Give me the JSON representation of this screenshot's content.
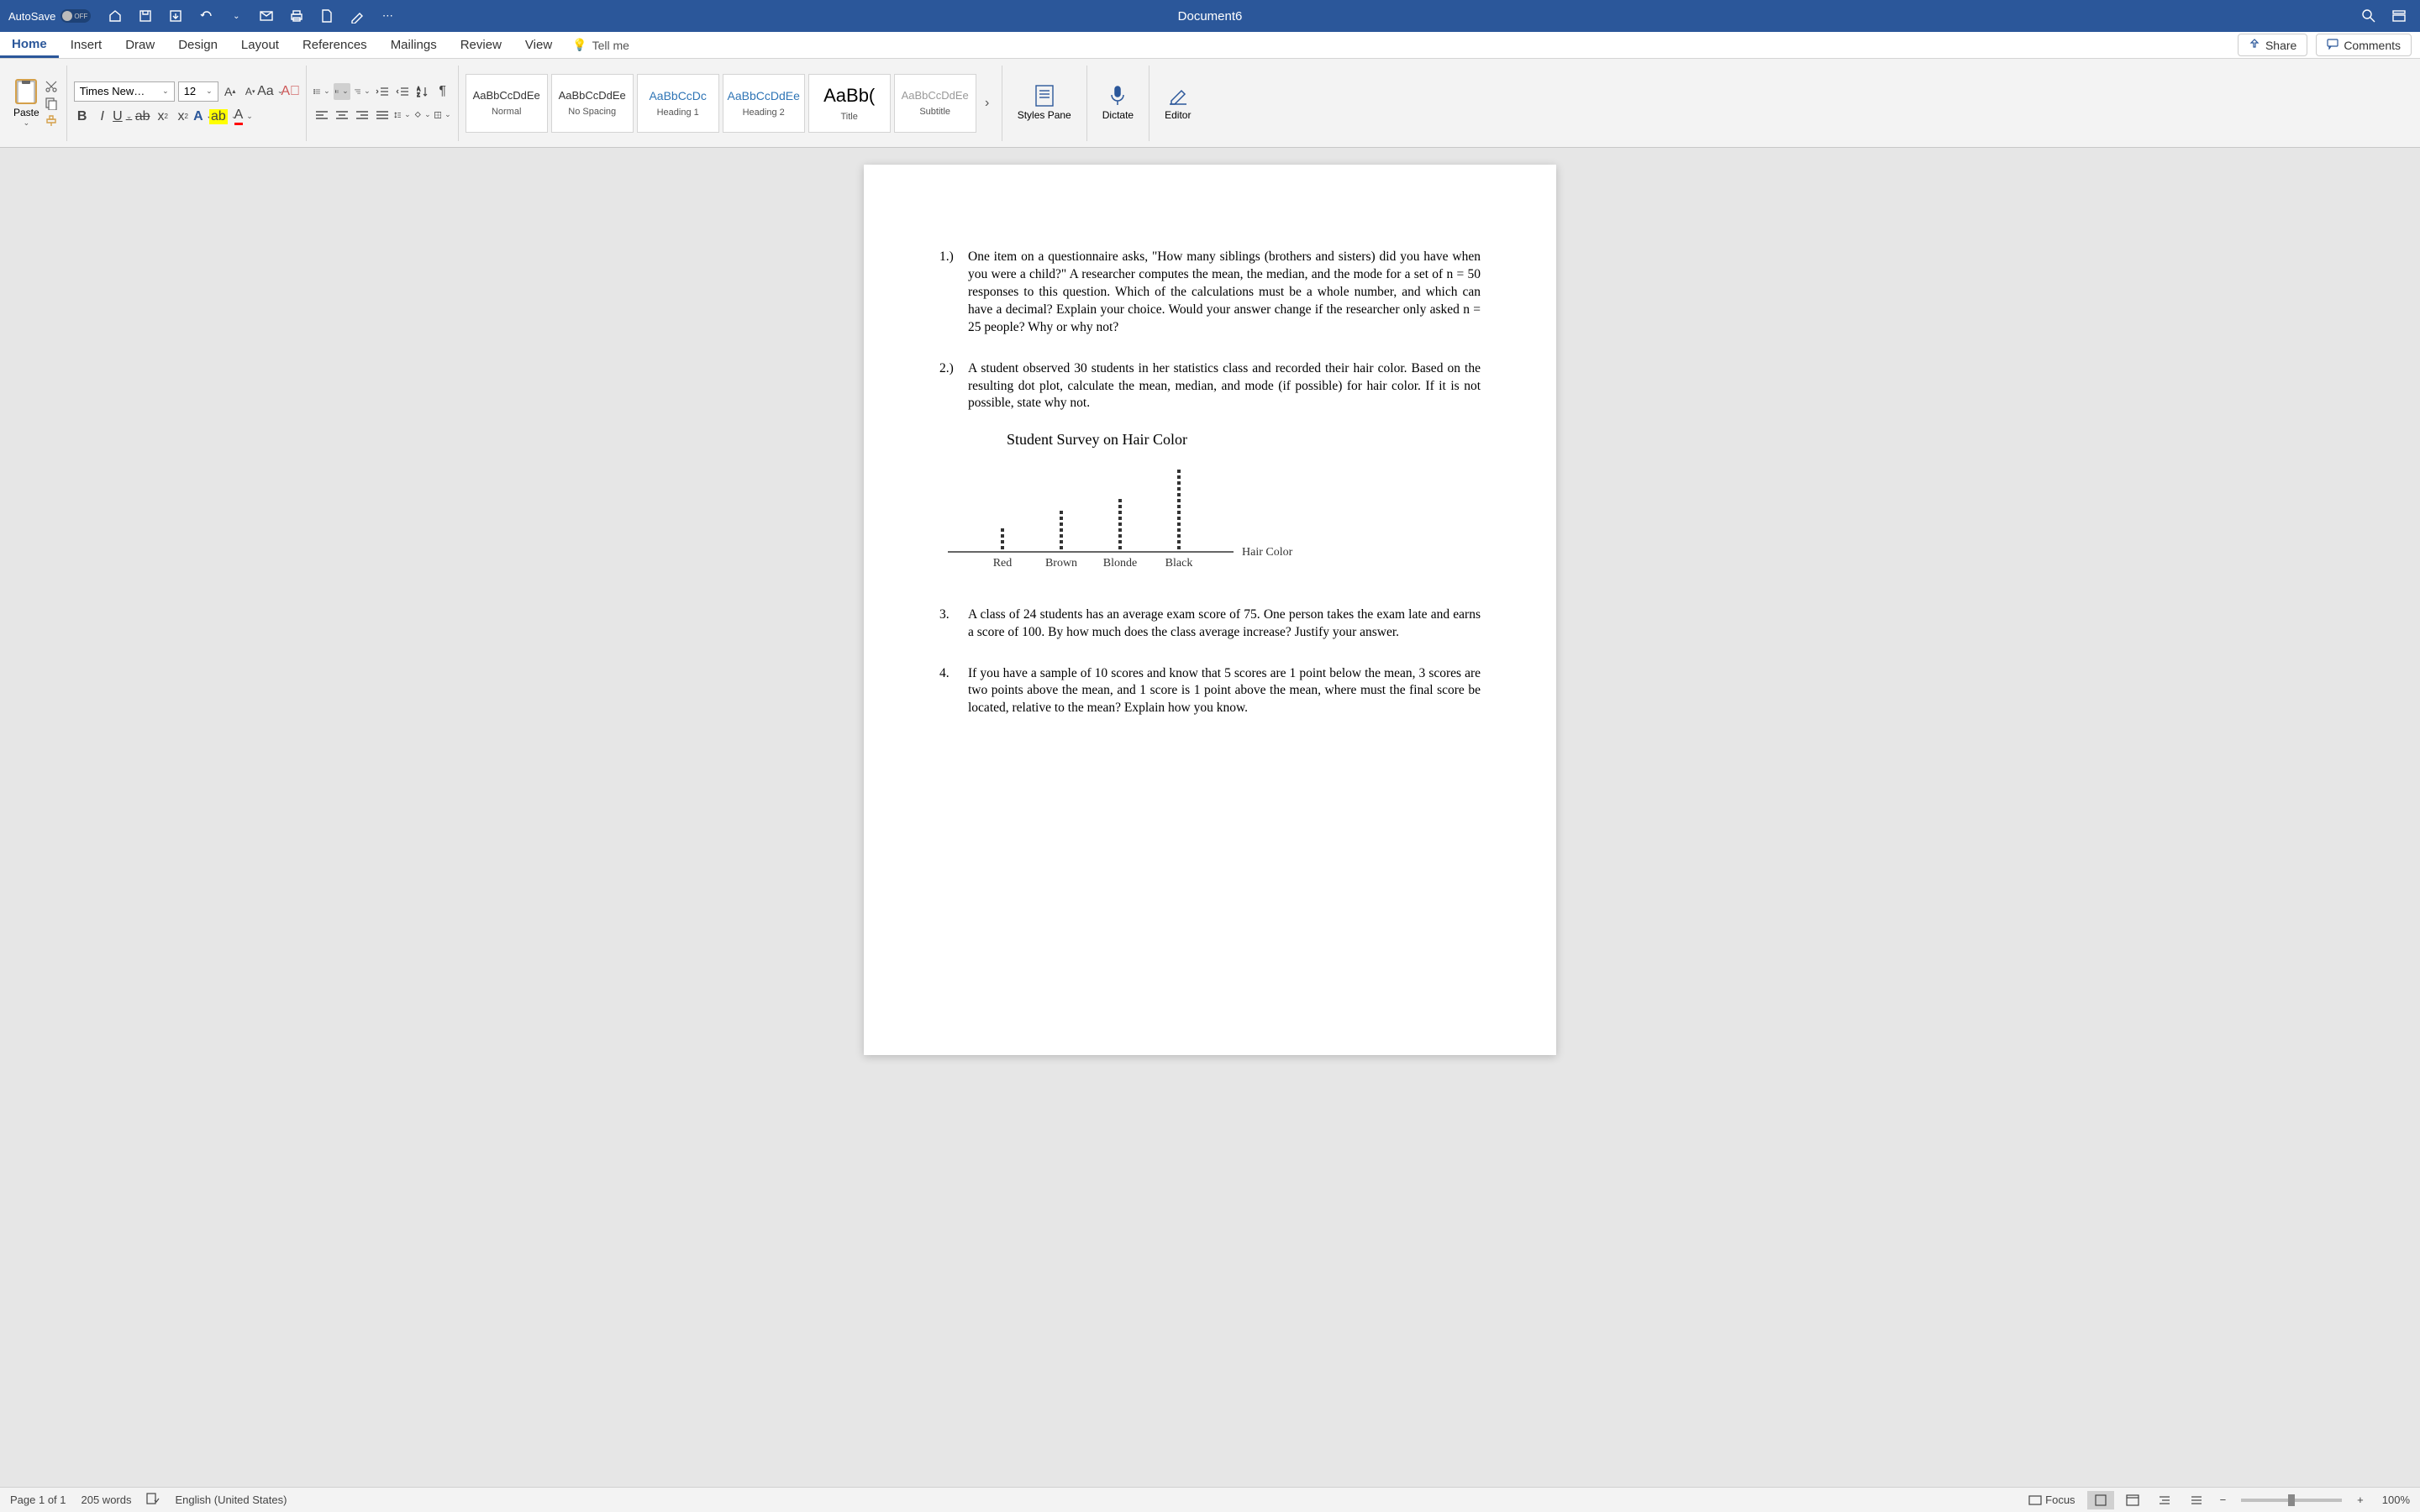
{
  "titlebar": {
    "autosave_label": "AutoSave",
    "autosave_state": "OFF",
    "doc_title": "Document6"
  },
  "ribbon": {
    "tabs": [
      "Home",
      "Insert",
      "Draw",
      "Design",
      "Layout",
      "References",
      "Mailings",
      "Review",
      "View"
    ],
    "tell_me": "Tell me",
    "share": "Share",
    "comments": "Comments"
  },
  "ribbon_content": {
    "paste": "Paste",
    "font_name": "Times New…",
    "font_size": "12",
    "styles": [
      {
        "preview": "AaBbCcDdEe",
        "label": "Normal"
      },
      {
        "preview": "AaBbCcDdEe",
        "label": "No Spacing"
      },
      {
        "preview": "AaBbCcDc",
        "label": "Heading 1"
      },
      {
        "preview": "AaBbCcDdEe",
        "label": "Heading 2"
      },
      {
        "preview": "AaBb(",
        "label": "Title"
      },
      {
        "preview": "AaBbCcDdEe",
        "label": "Subtitle"
      }
    ],
    "styles_pane": "Styles Pane",
    "dictate": "Dictate",
    "editor": "Editor"
  },
  "document": {
    "questions": [
      {
        "num": "1.)",
        "text": "One item on a questionnaire asks, \"How many siblings (brothers and sisters) did you have when you were a child?\" A researcher computes the mean, the median, and the mode for a set of n = 50 responses to this question. Which of the calculations must be a whole number, and which can have a decimal? Explain your choice. Would your answer change if the researcher only asked n = 25 people? Why or why not?"
      },
      {
        "num": "2.)",
        "text": "A student observed 30 students in her statistics class and recorded their hair color. Based on the resulting dot plot, calculate the mean, median, and mode (if possible) for hair color. If it is not possible, state why not."
      },
      {
        "num": "3.",
        "text": "A class of 24 students has an average exam score of 75. One person takes the exam late and earns a score of 100. By how much does the class average increase? Justify your answer."
      },
      {
        "num": "4.",
        "text": "If you have a sample of 10 scores and know that 5 scores are 1 point below the mean, 3 scores are two points above the mean, and 1 score is 1 point above the mean, where must the final score be located, relative to the mean? Explain how you know."
      }
    ]
  },
  "chart_data": {
    "type": "dotplot",
    "title": "Student Survey on Hair Color",
    "xlabel": "Hair Color",
    "categories": [
      "Red",
      "Brown",
      "Blonde",
      "Black"
    ],
    "values": [
      4,
      7,
      9,
      14
    ]
  },
  "statusbar": {
    "page": "Page 1 of 1",
    "words": "205 words",
    "language": "English (United States)",
    "focus": "Focus",
    "zoom": "100%"
  }
}
